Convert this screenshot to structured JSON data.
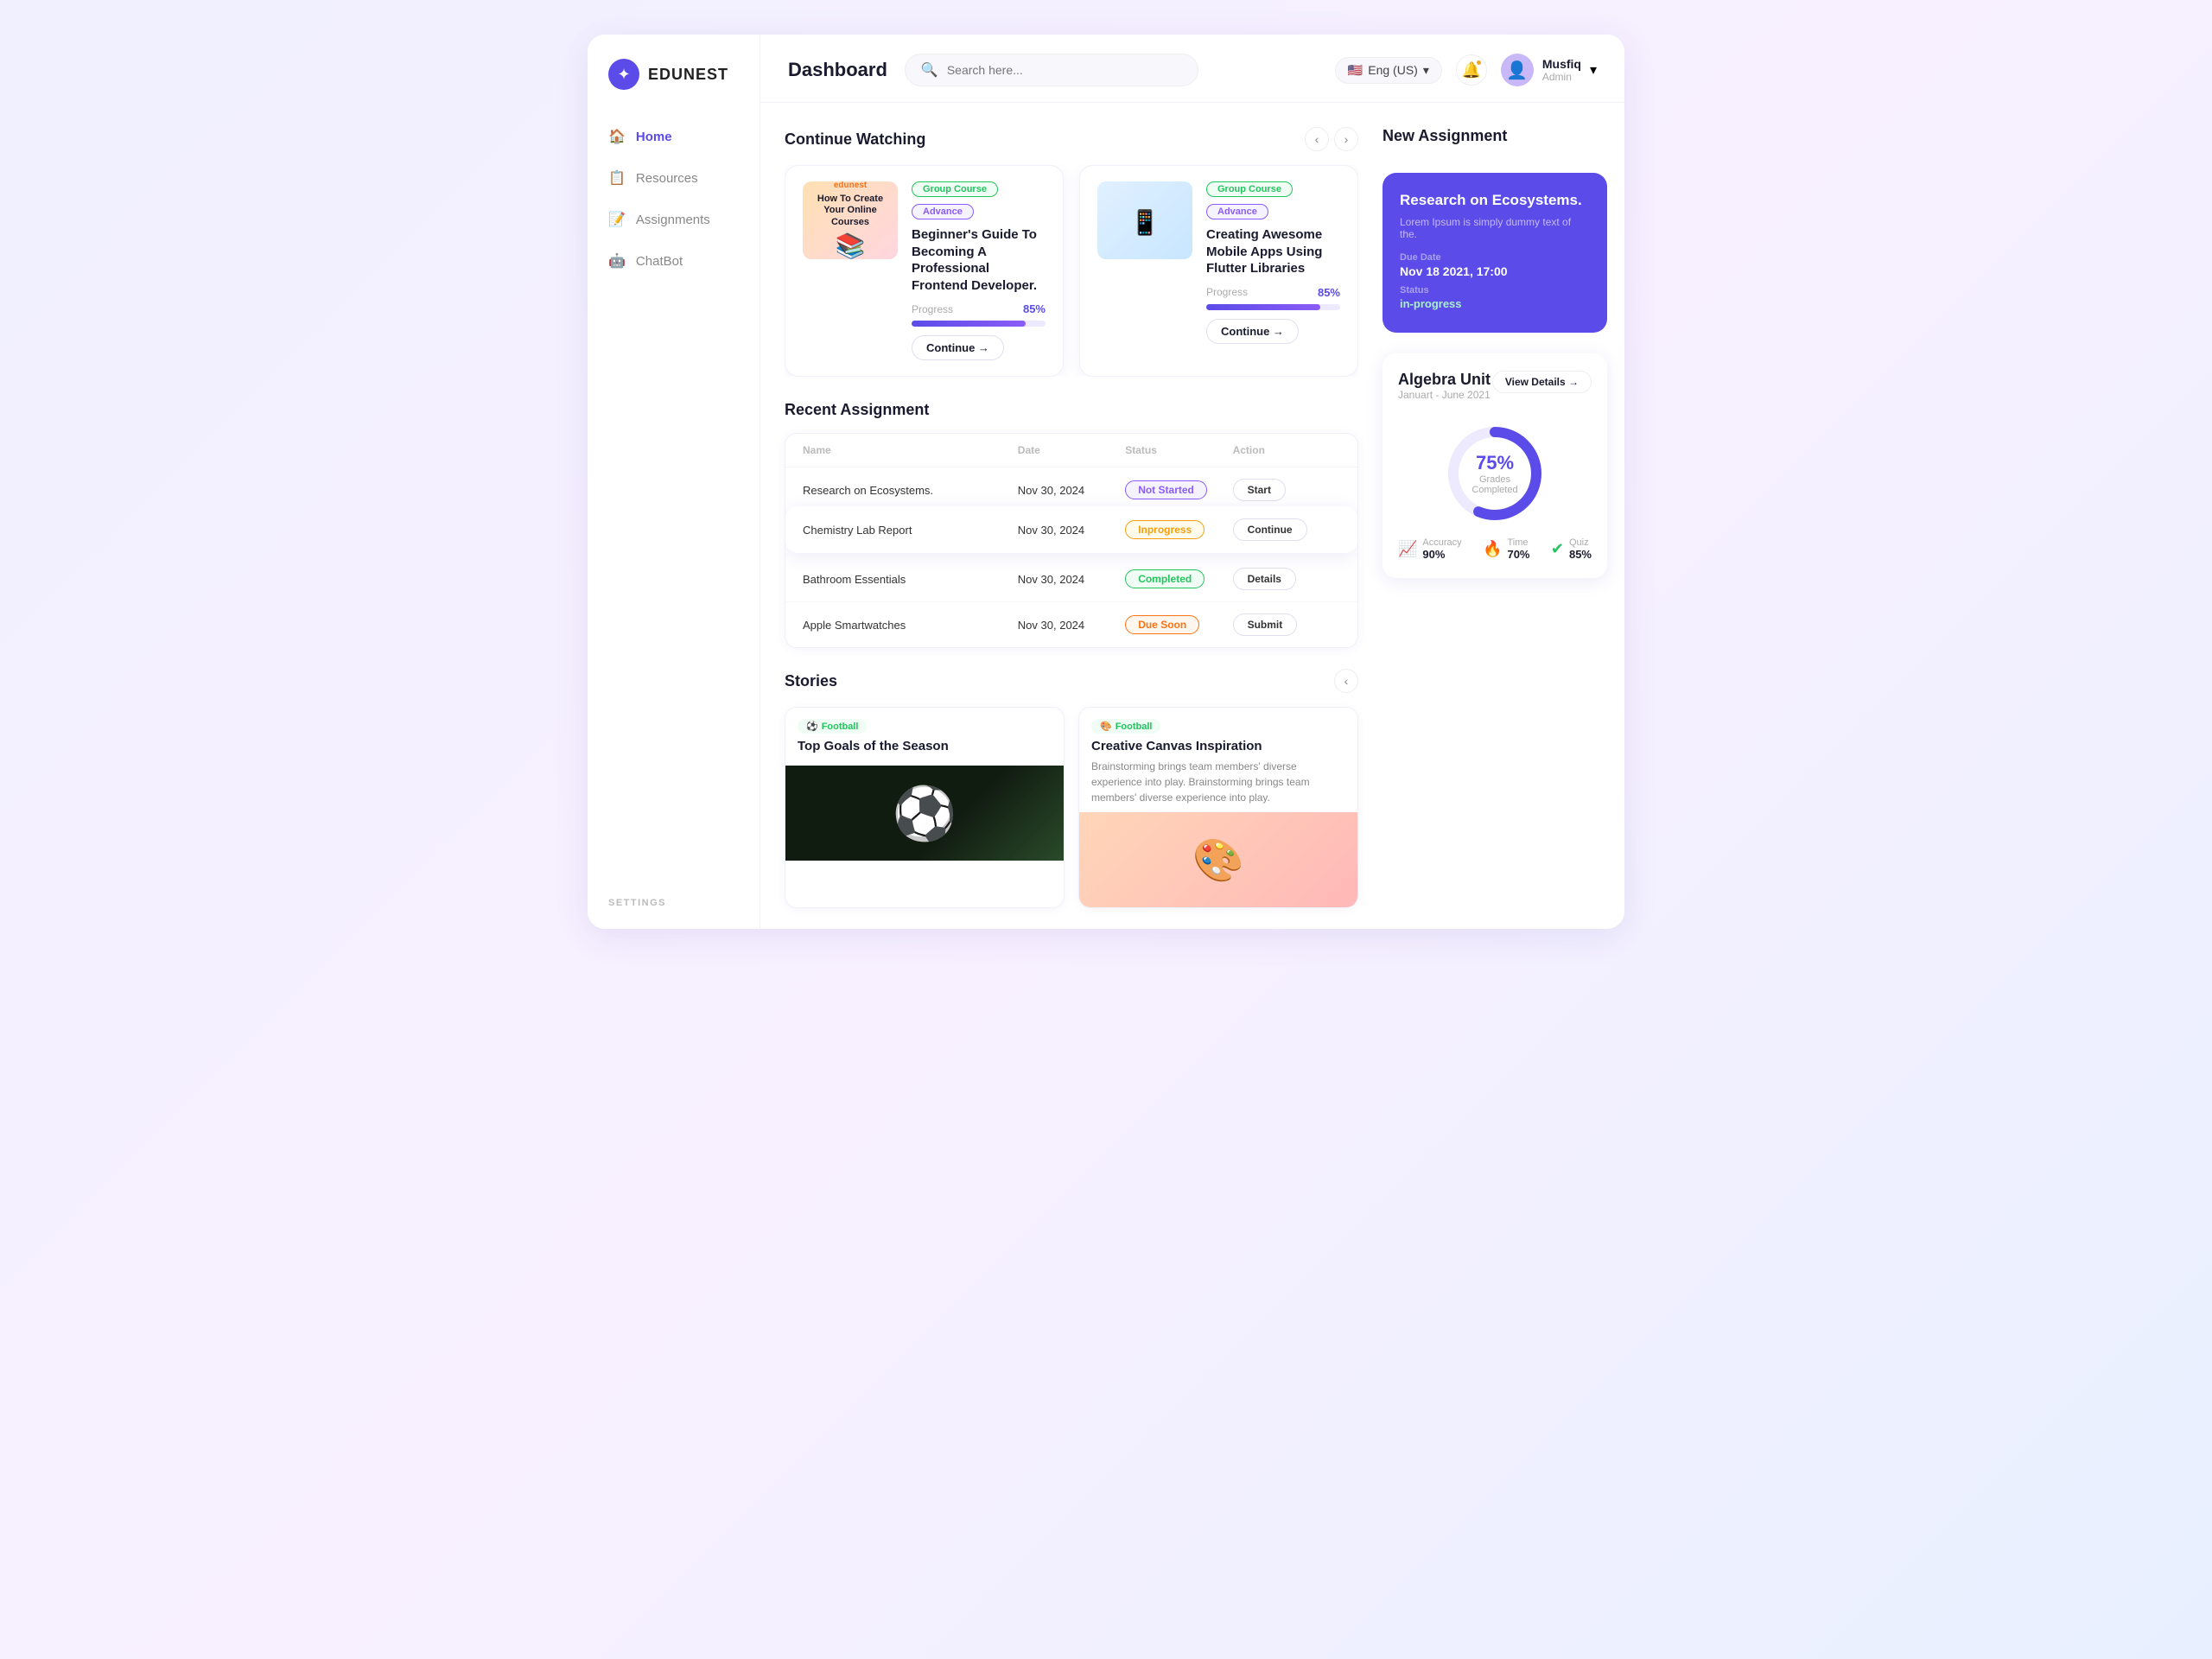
{
  "app": {
    "name": "EDUNEST",
    "logo_icon": "✦"
  },
  "header": {
    "title": "Dashboard",
    "search_placeholder": "Search here...",
    "language": "Eng (US)",
    "user": {
      "name": "Musfiq",
      "role": "Admin"
    }
  },
  "sidebar": {
    "items": [
      {
        "id": "home",
        "label": "Home",
        "icon": "🏠",
        "active": true
      },
      {
        "id": "resources",
        "label": "Resources",
        "icon": "📋",
        "active": false
      },
      {
        "id": "assignments",
        "label": "Assignments",
        "icon": "📝",
        "active": false
      },
      {
        "id": "chatbot",
        "label": "ChatBot",
        "icon": "🤖",
        "active": false
      }
    ],
    "settings_label": "SETTINGS"
  },
  "continue_watching": {
    "section_title": "Continue Watching",
    "cards": [
      {
        "id": "course-1",
        "thumb_emoji": "📚",
        "thumb_bg": "#ffe5cc",
        "title_short": "How To Create Your Online Courses",
        "tags": [
          "Group Course",
          "Advance"
        ],
        "full_title": "Beginner's Guide To Becoming A Professional Frontend Developer.",
        "progress_label": "Progress",
        "progress_pct": "85%",
        "progress_value": 85,
        "continue_label": "Continue →"
      },
      {
        "id": "course-2",
        "thumb_emoji": "📱",
        "thumb_bg": "#c8e6ff",
        "title_short": "Creating Awesome Mobile Apps Using Flutter Libraries",
        "tags": [
          "Group Course",
          "Advance"
        ],
        "full_title": "Creating  Awesome Mobile Apps Using Flutter Libraries",
        "progress_label": "Progress",
        "progress_pct": "85%",
        "progress_value": 85,
        "continue_label": "Continue →"
      }
    ]
  },
  "recent_assignment": {
    "section_title": "Recent  Assignment",
    "columns": [
      "Name",
      "Date",
      "Status",
      "Action"
    ],
    "rows": [
      {
        "name": "Research on Ecosystems.",
        "date": "Nov 30, 2024",
        "status": "Not Started",
        "status_class": "status-not-started",
        "action": "Start"
      },
      {
        "name": "Chemistry Lab Report",
        "date": "Nov 30, 2024",
        "status": "Inprogress",
        "status_class": "status-inprogress",
        "action": "Continue",
        "floating": true
      },
      {
        "name": "Bathroom Essentials",
        "date": "Nov 30, 2024",
        "status": "Completed",
        "status_class": "status-completed",
        "action": "Details"
      },
      {
        "name": "Apple Smartwatches",
        "date": "Nov 30, 2024",
        "status": "Due Soon",
        "status_class": "status-due-soon",
        "action": "Submit"
      }
    ]
  },
  "stories": {
    "section_title": "Stories",
    "items": [
      {
        "id": "story-1",
        "category": "Football",
        "category_icon": "⚽",
        "title": "Top Goals of the Season",
        "desc": "",
        "img_emoji": "⚽",
        "img_bg": "#1a2e1a"
      },
      {
        "id": "story-2",
        "category": "Football",
        "category_icon": "🎨",
        "title": "Creative Canvas Inspiration",
        "desc": "Brainstorming brings team members' diverse experience into play. Brainstorming brings team members' diverse experience into play.",
        "img_emoji": "🎨",
        "img_bg": "#ffd6cc"
      }
    ]
  },
  "new_assignment": {
    "section_title": "New  Assignment",
    "title": "Research on Ecosystems.",
    "description": "Lorem Ipsum is simply dummy text of the.",
    "due_date_label": "Due Date",
    "due_date_value": "Nov 18 2021, 17:00",
    "status_label": "Status",
    "status_value": "in-progress"
  },
  "algebra_unit": {
    "title": "Algebra Unit",
    "date_range": "Januart - June 2021",
    "view_details_label": "View Details →",
    "progress_pct": 75,
    "progress_label": "Grades Completed",
    "stats": [
      {
        "icon": "📈",
        "label": "Accuracy",
        "value": "90%",
        "color": "#5b4be8"
      },
      {
        "icon": "🔥",
        "label": "Time",
        "value": "70%",
        "color": "#f97316"
      },
      {
        "icon": "✔",
        "label": "Quiz",
        "value": "85%",
        "color": "#22c55e"
      }
    ]
  }
}
